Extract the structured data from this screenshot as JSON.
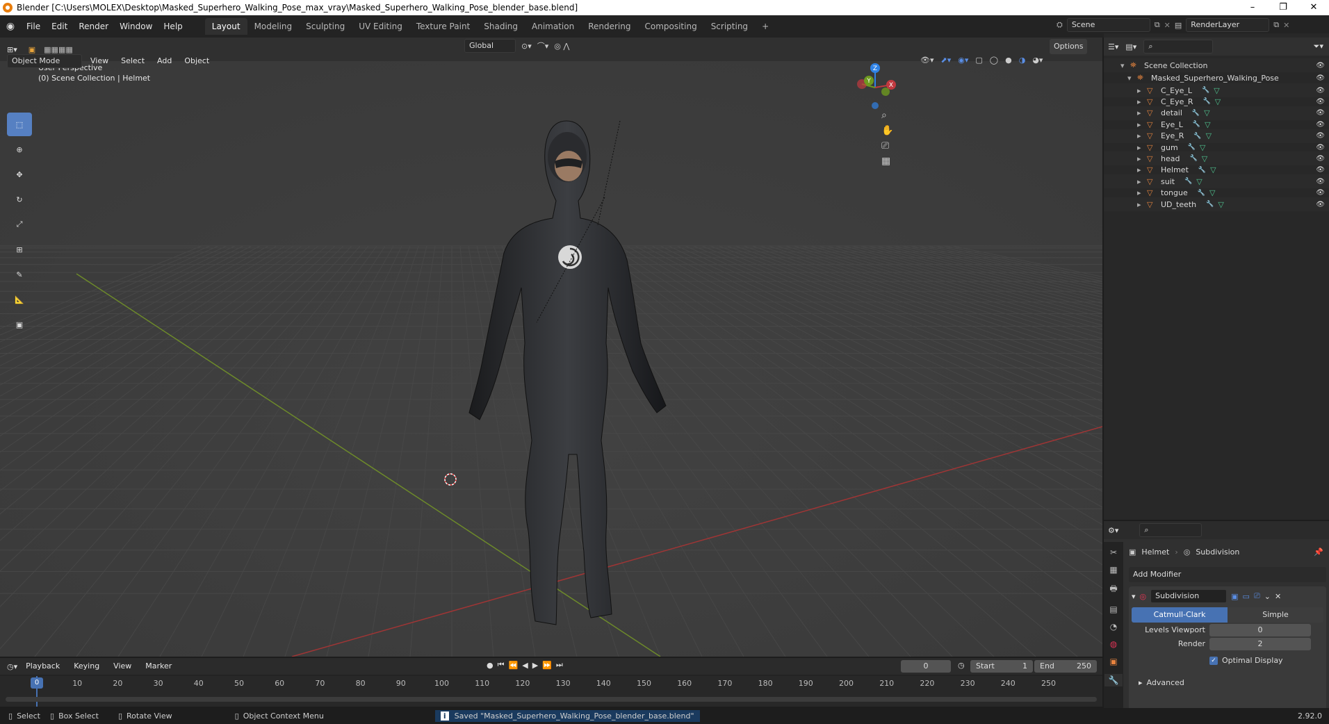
{
  "title": "Blender [C:\\Users\\MOLEX\\Desktop\\Masked_Superhero_Walking_Pose_max_vray\\Masked_Superhero_Walking_Pose_blender_base.blend]",
  "menus": [
    "File",
    "Edit",
    "Render",
    "Window",
    "Help"
  ],
  "workspaces": [
    "Layout",
    "Modeling",
    "Sculpting",
    "UV Editing",
    "Texture Paint",
    "Shading",
    "Animation",
    "Rendering",
    "Compositing",
    "Scripting"
  ],
  "scene": "Scene",
  "render_layer": "RenderLayer",
  "viewport": {
    "mode": "Object Mode",
    "menus": [
      "View",
      "Select",
      "Add",
      "Object"
    ],
    "orientation": "Global",
    "options_label": "Options",
    "overlay_line1": "User Perspective",
    "overlay_line2": "(0) Scene Collection | Helmet",
    "gizmo": {
      "z": "Z",
      "y": "Y",
      "x": "X"
    }
  },
  "outliner": {
    "root": "Scene Collection",
    "collection": "Masked_Superhero_Walking_Pose",
    "objects": [
      "C_Eye_L",
      "C_Eye_R",
      "detail",
      "Eye_L",
      "Eye_R",
      "gum",
      "head",
      "Helmet",
      "suit",
      "tongue",
      "UD_teeth"
    ],
    "selected": "Helmet"
  },
  "properties": {
    "object": "Helmet",
    "modifier_breadcrumb": "Subdivision",
    "add_modifier": "Add Modifier",
    "modifier_name": "Subdivision",
    "catmull": "Catmull-Clark",
    "simple": "Simple",
    "levels_viewport_label": "Levels Viewport",
    "levels_viewport": "0",
    "render_label": "Render",
    "render_value": "2",
    "optimal_display": "Optimal Display",
    "advanced": "Advanced"
  },
  "timeline": {
    "menus": [
      "Playback",
      "Keying",
      "View",
      "Marker"
    ],
    "current_frame": "0",
    "start_label": "Start",
    "start": "1",
    "end_label": "End",
    "end": "250",
    "ticks": [
      "0",
      "10",
      "20",
      "30",
      "40",
      "50",
      "60",
      "70",
      "80",
      "90",
      "100",
      "110",
      "120",
      "130",
      "140",
      "150",
      "160",
      "170",
      "180",
      "190",
      "200",
      "210",
      "220",
      "230",
      "240",
      "250"
    ]
  },
  "status": {
    "select": "Select",
    "box_select": "Box Select",
    "rotate_view": "Rotate View",
    "context_menu": "Object Context Menu",
    "message": "Saved \"Masked_Superhero_Walking_Pose_blender_base.blend\"",
    "version": "2.92.0"
  },
  "colors": {
    "accent": "#4772b3",
    "object_icon": "#e3833e",
    "mesh_icon": "#4fc38f",
    "x_axis": "#c0393f",
    "y_axis": "#6e9a1f",
    "z_axis": "#2f82e5"
  }
}
